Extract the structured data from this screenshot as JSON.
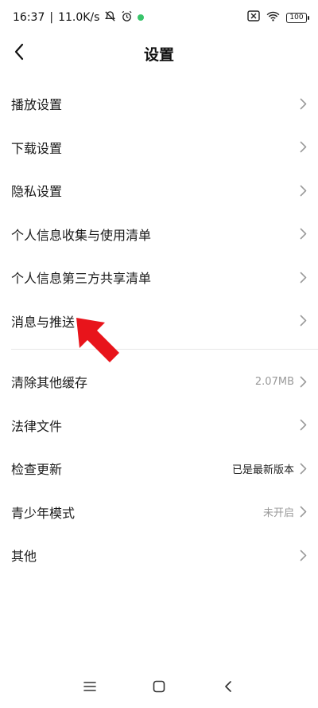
{
  "status": {
    "time": "16:37",
    "net_speed": "11.0K/s",
    "battery": "100"
  },
  "header": {
    "title": "设置"
  },
  "group1": [
    {
      "label": "播放设置"
    },
    {
      "label": "下载设置"
    },
    {
      "label": "隐私设置"
    },
    {
      "label": "个人信息收集与使用清单"
    },
    {
      "label": "个人信息第三方共享清单"
    },
    {
      "label": "消息与推送"
    }
  ],
  "group2": [
    {
      "label": "清除其他缓存",
      "value": "2.07MB"
    },
    {
      "label": "法律文件",
      "value": ""
    },
    {
      "label": "检查更新",
      "value": "已是最新版本"
    },
    {
      "label": "青少年模式",
      "value": "未开启"
    },
    {
      "label": "其他",
      "value": ""
    }
  ],
  "colors": {
    "annotation_arrow": "#e8141b",
    "chevron": "#9a9a9a"
  },
  "icons": {
    "back": "chevron-left-icon",
    "menu": "menu-icon",
    "home": "home-square-icon",
    "nav_back": "back-triangle-icon"
  }
}
